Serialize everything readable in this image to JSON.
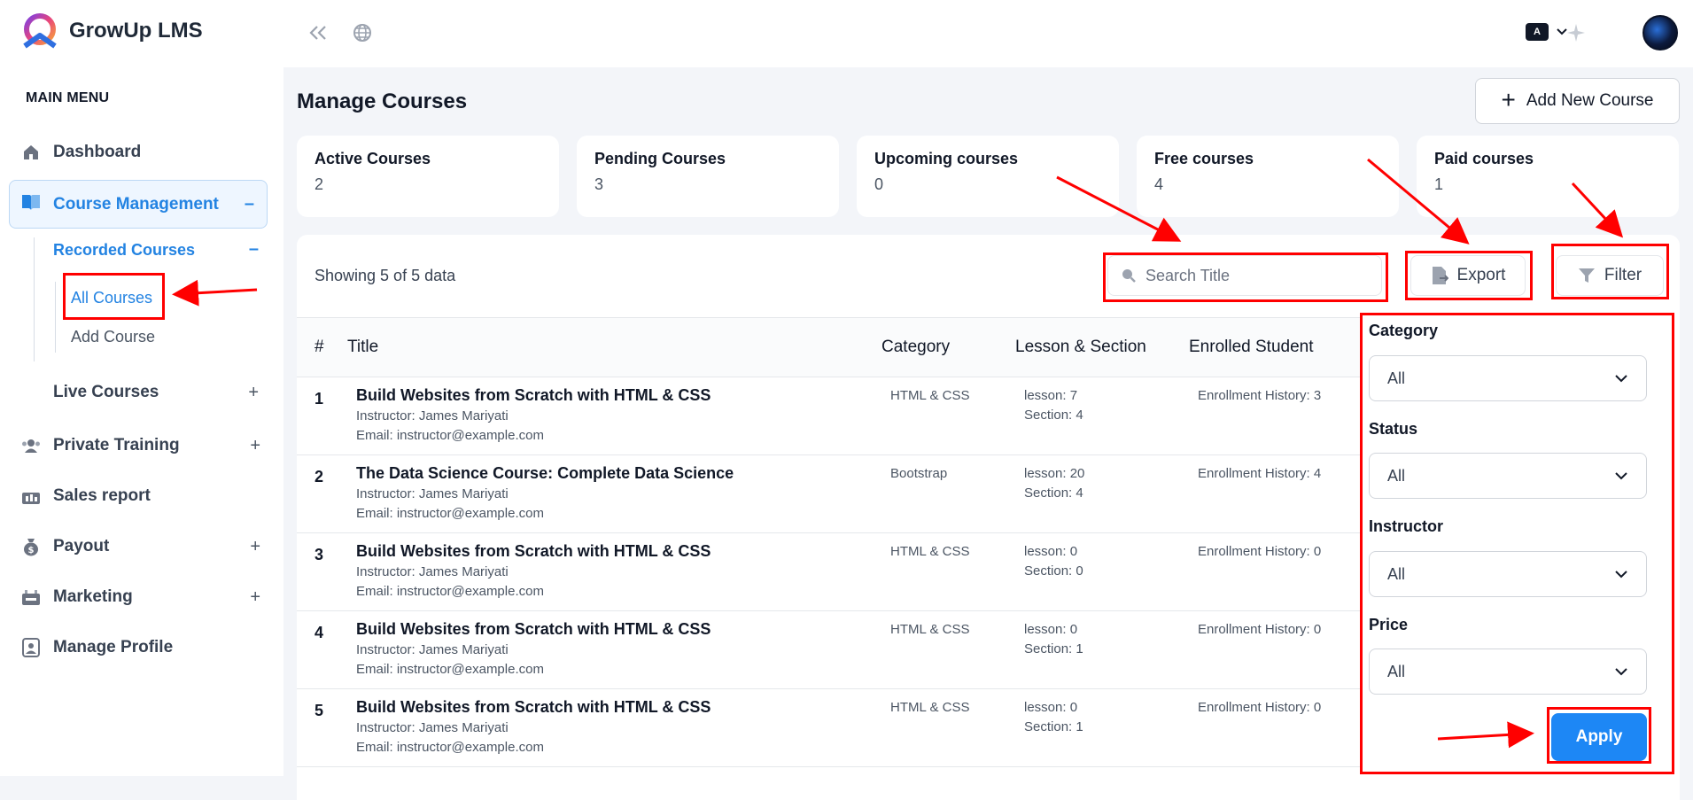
{
  "app": {
    "name": "GrowUp LMS"
  },
  "sidebar": {
    "section_title": "MAIN MENU",
    "items": [
      {
        "label": "Dashboard"
      },
      {
        "label": "Course Management"
      },
      {
        "label": "Private Training"
      },
      {
        "label": "Sales report"
      },
      {
        "label": "Payout"
      },
      {
        "label": "Marketing"
      },
      {
        "label": "Manage Profile"
      }
    ],
    "recorded_courses": "Recorded Courses",
    "all_courses": "All Courses",
    "add_course": "Add Course",
    "live_courses": "Live Courses",
    "expand_symbol": "+",
    "collapse_symbol": "–"
  },
  "topbar": {
    "lang_badge": "A"
  },
  "page": {
    "title": "Manage Courses",
    "add_button": "Add New Course"
  },
  "stats": [
    {
      "label": "Active Courses",
      "value": "2"
    },
    {
      "label": "Pending Courses",
      "value": "3"
    },
    {
      "label": "Upcoming courses",
      "value": "0"
    },
    {
      "label": "Free courses",
      "value": "4"
    },
    {
      "label": "Paid courses",
      "value": "1"
    }
  ],
  "toolbar": {
    "showing": "Showing 5 of 5 data",
    "search_placeholder": "Search Title",
    "export": "Export",
    "filter": "Filter"
  },
  "table": {
    "headers": [
      "#",
      "Title",
      "Category",
      "Lesson & Section",
      "Enrolled Student"
    ],
    "rows": [
      {
        "num": "1",
        "title": "Build Websites from Scratch with HTML & CSS",
        "instructor": "Instructor: James Mariyati",
        "email": "Email: instructor@example.com",
        "category": "HTML & CSS",
        "lesson": "lesson: 7",
        "section": "Section: 4",
        "enroll": "Enrollment History: 3"
      },
      {
        "num": "2",
        "title": "The Data Science Course: Complete Data Science",
        "instructor": "Instructor: James Mariyati",
        "email": "Email: instructor@example.com",
        "category": "Bootstrap",
        "lesson": "lesson: 20",
        "section": "Section: 4",
        "enroll": "Enrollment History: 4"
      },
      {
        "num": "3",
        "title": "Build Websites from Scratch with HTML & CSS",
        "instructor": "Instructor: James Mariyati",
        "email": "Email: instructor@example.com",
        "category": "HTML & CSS",
        "lesson": "lesson: 0",
        "section": "Section: 0",
        "enroll": "Enrollment History: 0"
      },
      {
        "num": "4",
        "title": "Build Websites from Scratch with HTML & CSS",
        "instructor": "Instructor: James Mariyati",
        "email": "Email: instructor@example.com",
        "category": "HTML & CSS",
        "lesson": "lesson: 0",
        "section": "Section: 1",
        "enroll": "Enrollment History: 0"
      },
      {
        "num": "5",
        "title": "Build Websites from Scratch with HTML & CSS",
        "instructor": "Instructor: James Mariyati",
        "email": "Email: instructor@example.com",
        "category": "HTML & CSS",
        "lesson": "lesson: 0",
        "section": "Section: 1",
        "enroll": "Enrollment History: 0"
      }
    ]
  },
  "filter_panel": {
    "fields": [
      {
        "label": "Category",
        "value": "All"
      },
      {
        "label": "Status",
        "value": "All"
      },
      {
        "label": "Instructor",
        "value": "All"
      },
      {
        "label": "Price",
        "value": "All"
      }
    ],
    "apply": "Apply"
  },
  "colors": {
    "accent": "#2383e2",
    "apply_button": "#1d87f5",
    "annotation": "#ff0000"
  }
}
